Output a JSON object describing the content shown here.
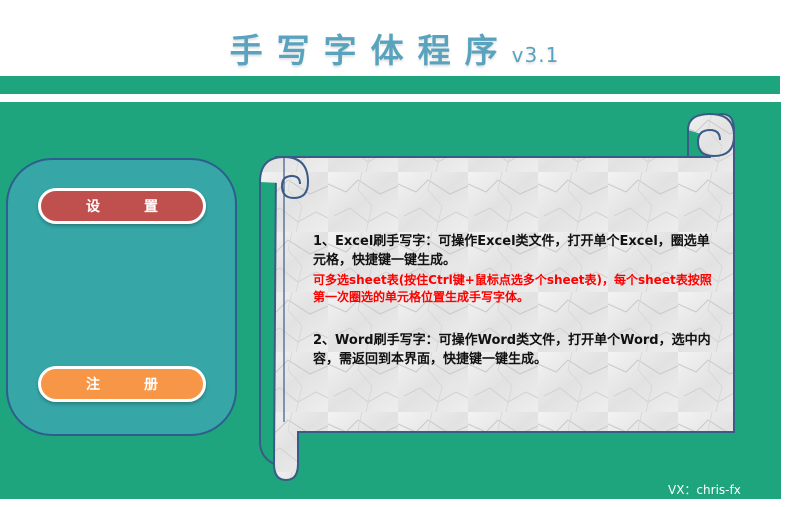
{
  "app": {
    "title": "手写字体程序",
    "version": "v3.1"
  },
  "sidebar": {
    "settings_label": "设置",
    "register_label": "注册"
  },
  "instructions": {
    "item1": "1、Excel刷手写字：可操作Excel类文件，打开单个Excel，圈选单元格，快捷键一键生成。",
    "item1_note": "可多选sheet表(按住Ctrl键+鼠标点选多个sheet表)，每个sheet表按照第一次圈选的单元格位置生成手写字体。",
    "item2": "2、Word刷手写字：可操作Word类文件，打开单个Word，选中内容，需返回到本界面，快捷键一键生成。"
  },
  "footer": {
    "contact": "VX：chris-fx"
  },
  "colors": {
    "background_green": "#1fa57d",
    "panel_teal": "#36a6a6",
    "settings_button": "#c0504d",
    "register_button": "#f79646",
    "title_blue": "#5aa3bf",
    "note_red": "#ff0000"
  }
}
